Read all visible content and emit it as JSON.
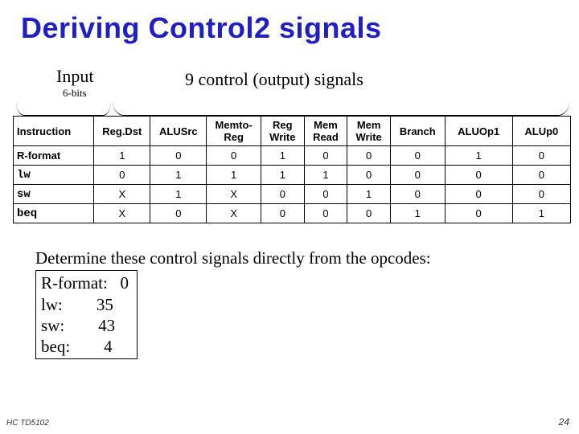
{
  "title": "Deriving Control2 signals",
  "labels": {
    "input": "Input",
    "input_sub": "6-bits",
    "output": "9 control (output) signals"
  },
  "chart_data": {
    "type": "table",
    "headers": [
      "Instruction",
      "Reg.Dst",
      "ALUSrc",
      "Memto-\nReg",
      "Reg\nWrite",
      "Mem\nRead",
      "Mem\nWrite",
      "Branch",
      "ALUOp1",
      "ALUp0"
    ],
    "rows": [
      {
        "instr": "R-format",
        "mono": false,
        "vals": [
          "1",
          "0",
          "0",
          "1",
          "0",
          "0",
          "0",
          "1",
          "0"
        ]
      },
      {
        "instr": "lw",
        "mono": true,
        "vals": [
          "0",
          "1",
          "1",
          "1",
          "1",
          "0",
          "0",
          "0",
          "0"
        ]
      },
      {
        "instr": "sw",
        "mono": true,
        "vals": [
          "X",
          "1",
          "X",
          "0",
          "0",
          "1",
          "0",
          "0",
          "0"
        ]
      },
      {
        "instr": "beq",
        "mono": true,
        "vals": [
          "X",
          "0",
          "X",
          "0",
          "0",
          "0",
          "1",
          "0",
          "1"
        ]
      }
    ]
  },
  "caption": {
    "line": "Determine these control signals directly from the opcodes:",
    "ops": [
      {
        "name": "R-format:",
        "val": "0"
      },
      {
        "name": "lw:",
        "val": "35"
      },
      {
        "name": "sw:",
        "val": "43"
      },
      {
        "name": "beq:",
        "val": "4"
      }
    ]
  },
  "footer": {
    "left": "HC TD5102",
    "right": "24"
  }
}
